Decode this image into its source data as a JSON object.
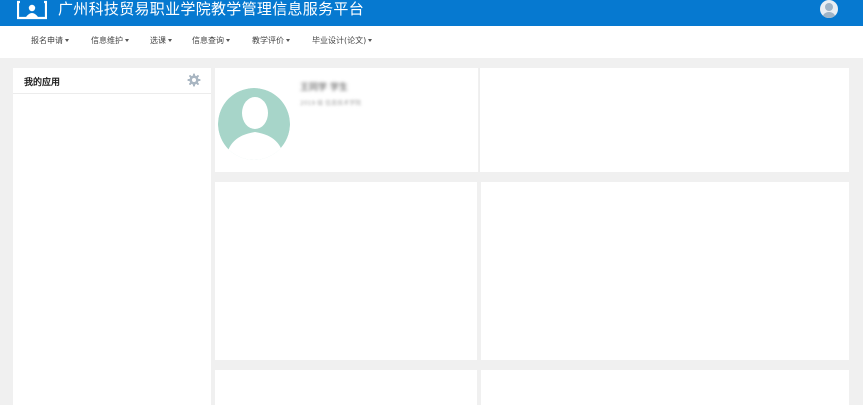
{
  "header": {
    "title": "广州科技贸易职业学院教学管理信息服务平台",
    "logo_icon": "campus-logo-icon",
    "user_icon": "user-avatar-icon",
    "background_color": "#0679d0"
  },
  "nav": {
    "items": [
      {
        "label": "报名申请"
      },
      {
        "label": "信息维护"
      },
      {
        "label": "选课"
      },
      {
        "label": "信息查询"
      },
      {
        "label": "教学评价"
      },
      {
        "label": "毕业设计(论文)"
      }
    ]
  },
  "sidebar": {
    "title": "我的应用",
    "settings_icon": "gear-icon"
  },
  "profile": {
    "name": "王同学 学生",
    "subtitle": "2019 级 信息技术学院",
    "avatar_icon": "default-avatar-icon"
  }
}
